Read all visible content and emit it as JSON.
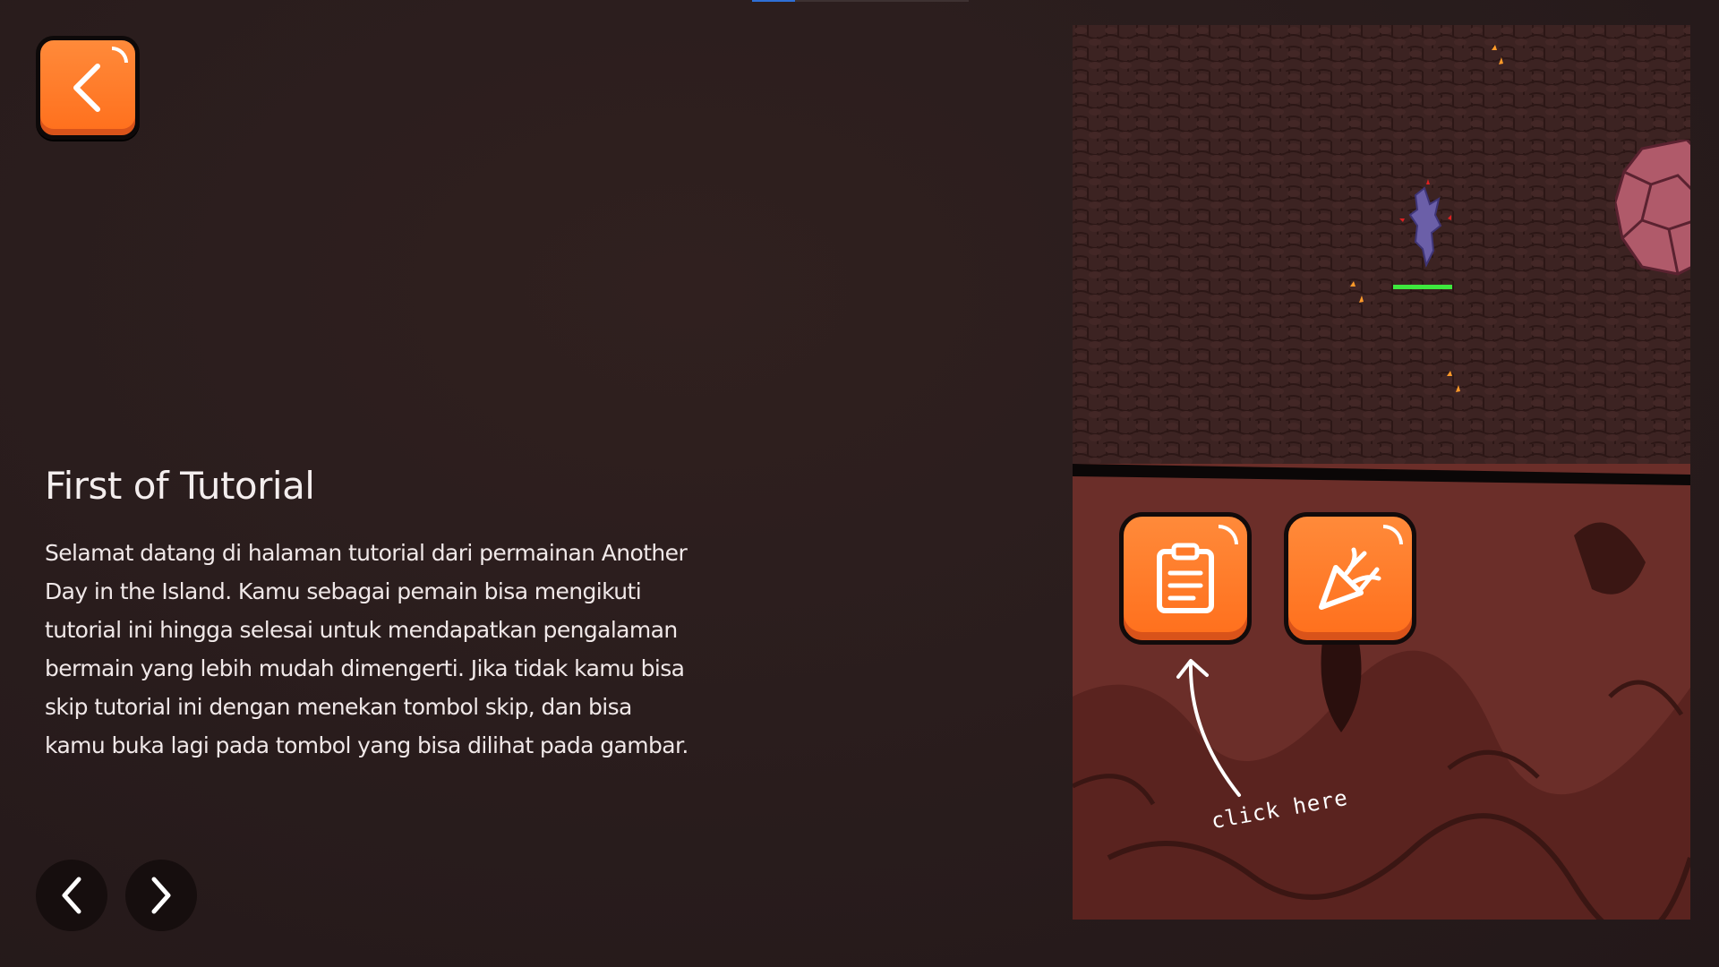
{
  "header": {
    "back_button_label": "Back",
    "progress_step": 1,
    "progress_total": 5
  },
  "tutorial": {
    "title": "First of Tutorial",
    "body": "Selamat datang di halaman tutorial dari permainan Another Day in the Island. Kamu sebagai pemain bisa mengikuti tutorial ini hingga selesai untuk mendapatkan pengalaman bermain yang lebih mudah dimengerti. Jika tidak kamu bisa skip tutorial ini dengan menekan tombol skip, dan bisa kamu buka lagi pada tombol yang bisa dilihat pada gambar."
  },
  "navigation": {
    "prev_icon": "chevron-left-icon",
    "next_icon": "chevron-right-icon"
  },
  "preview": {
    "quest_button_icon": "clipboard-icon",
    "skip_button_icon": "party-popper-icon",
    "hint_text": "click here"
  },
  "colors": {
    "accent_orange": "#ff7a2a",
    "background": "#2a1d1d",
    "player_health": "#3ee83e",
    "overlay_red": "#6e2f2a"
  }
}
